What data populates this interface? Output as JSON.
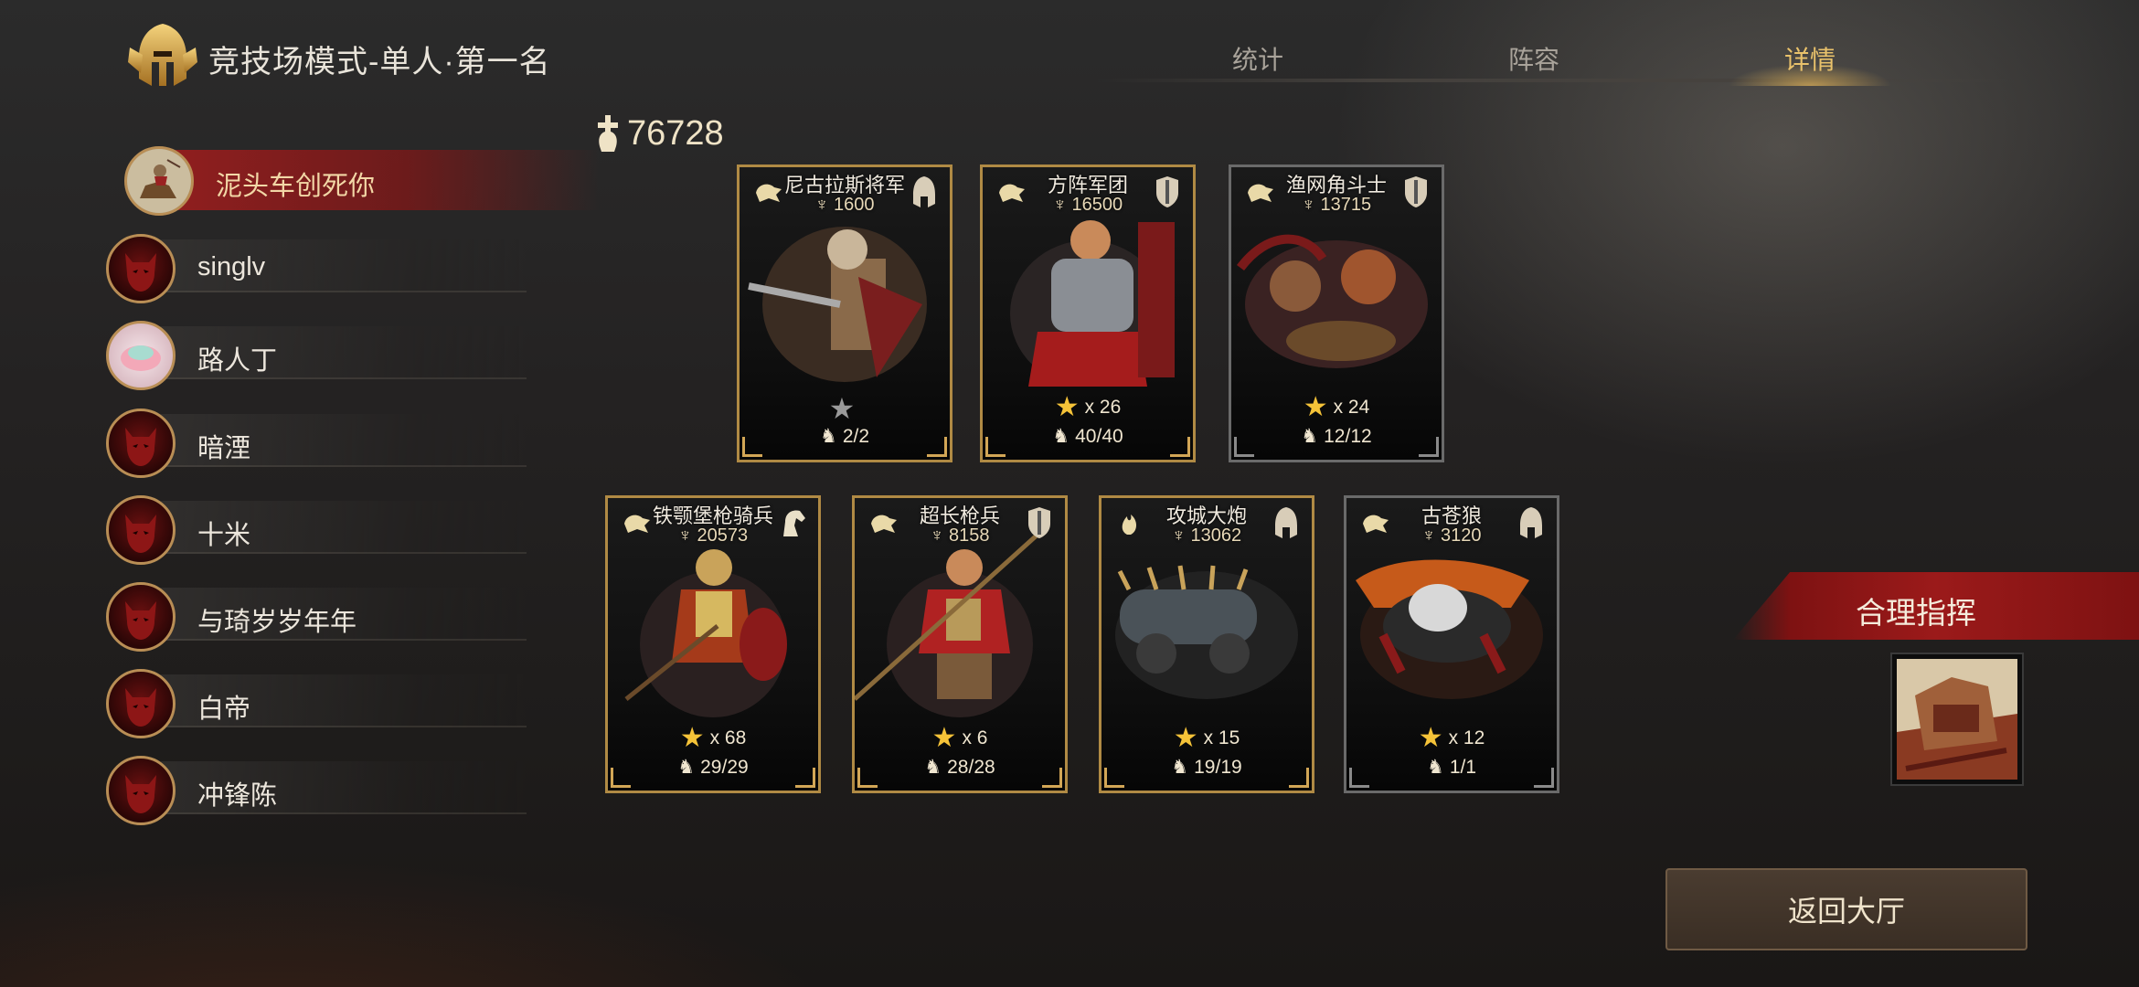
{
  "header": {
    "title": "竞技场模式-单人·第一名",
    "tabs": [
      {
        "label": "统计",
        "active": false
      },
      {
        "label": "阵容",
        "active": false
      },
      {
        "label": "详情",
        "active": true
      }
    ]
  },
  "total_power": "76728",
  "players": [
    {
      "name": "泥头车创死你",
      "selected": true,
      "avatar": "mounted-knight-avatar"
    },
    {
      "name": "singlv",
      "selected": false,
      "avatar": "demon-avatar"
    },
    {
      "name": "路人丁",
      "selected": false,
      "avatar": "pink-blob-avatar"
    },
    {
      "name": "暗湮",
      "selected": false,
      "avatar": "demon-avatar"
    },
    {
      "name": "十米",
      "selected": false,
      "avatar": "demon-avatar"
    },
    {
      "name": "与琦岁岁年年",
      "selected": false,
      "avatar": "demon-avatar"
    },
    {
      "name": "白帝",
      "selected": false,
      "avatar": "demon-avatar"
    },
    {
      "name": "冲锋陈",
      "selected": false,
      "avatar": "demon-avatar"
    }
  ],
  "units": [
    {
      "name": "尼古拉斯将军",
      "power": "1600",
      "stars": "",
      "troops": "2/2",
      "star_style": "grey",
      "type_icon": "helmet-icon",
      "dim": false
    },
    {
      "name": "方阵军团",
      "power": "16500",
      "stars": "x 26",
      "troops": "40/40",
      "star_style": "gold",
      "type_icon": "shield-icon",
      "dim": true
    },
    {
      "name": "渔网角斗士",
      "power": "13715",
      "stars": "x 24",
      "troops": "12/12",
      "star_style": "gold",
      "type_icon": "shield-icon",
      "dim": true
    },
    {
      "name": "铁颚堡枪骑兵",
      "power": "20573",
      "stars": "x 68",
      "troops": "29/29",
      "star_style": "gold",
      "type_icon": "horse-icon",
      "dim": false
    },
    {
      "name": "超长枪兵",
      "power": "8158",
      "stars": "x 6",
      "troops": "28/28",
      "star_style": "gold",
      "type_icon": "shield-icon",
      "dim": false
    },
    {
      "name": "攻城大炮",
      "power": "13062",
      "stars": "x 15",
      "troops": "19/19",
      "star_style": "gold",
      "type_icon": "helmet-icon",
      "dim": false
    },
    {
      "name": "古苍狼",
      "power": "3120",
      "stars": "x 12",
      "troops": "1/1",
      "star_style": "gold",
      "type_icon": "helmet-icon",
      "dim": true
    }
  ],
  "command": {
    "label": "合理指挥"
  },
  "return_button": {
    "label": "返回大厅"
  },
  "colors": {
    "accent_gold": "#e9c26b",
    "banner_red": "#9b1a1a",
    "card_border": "#b08a44"
  }
}
